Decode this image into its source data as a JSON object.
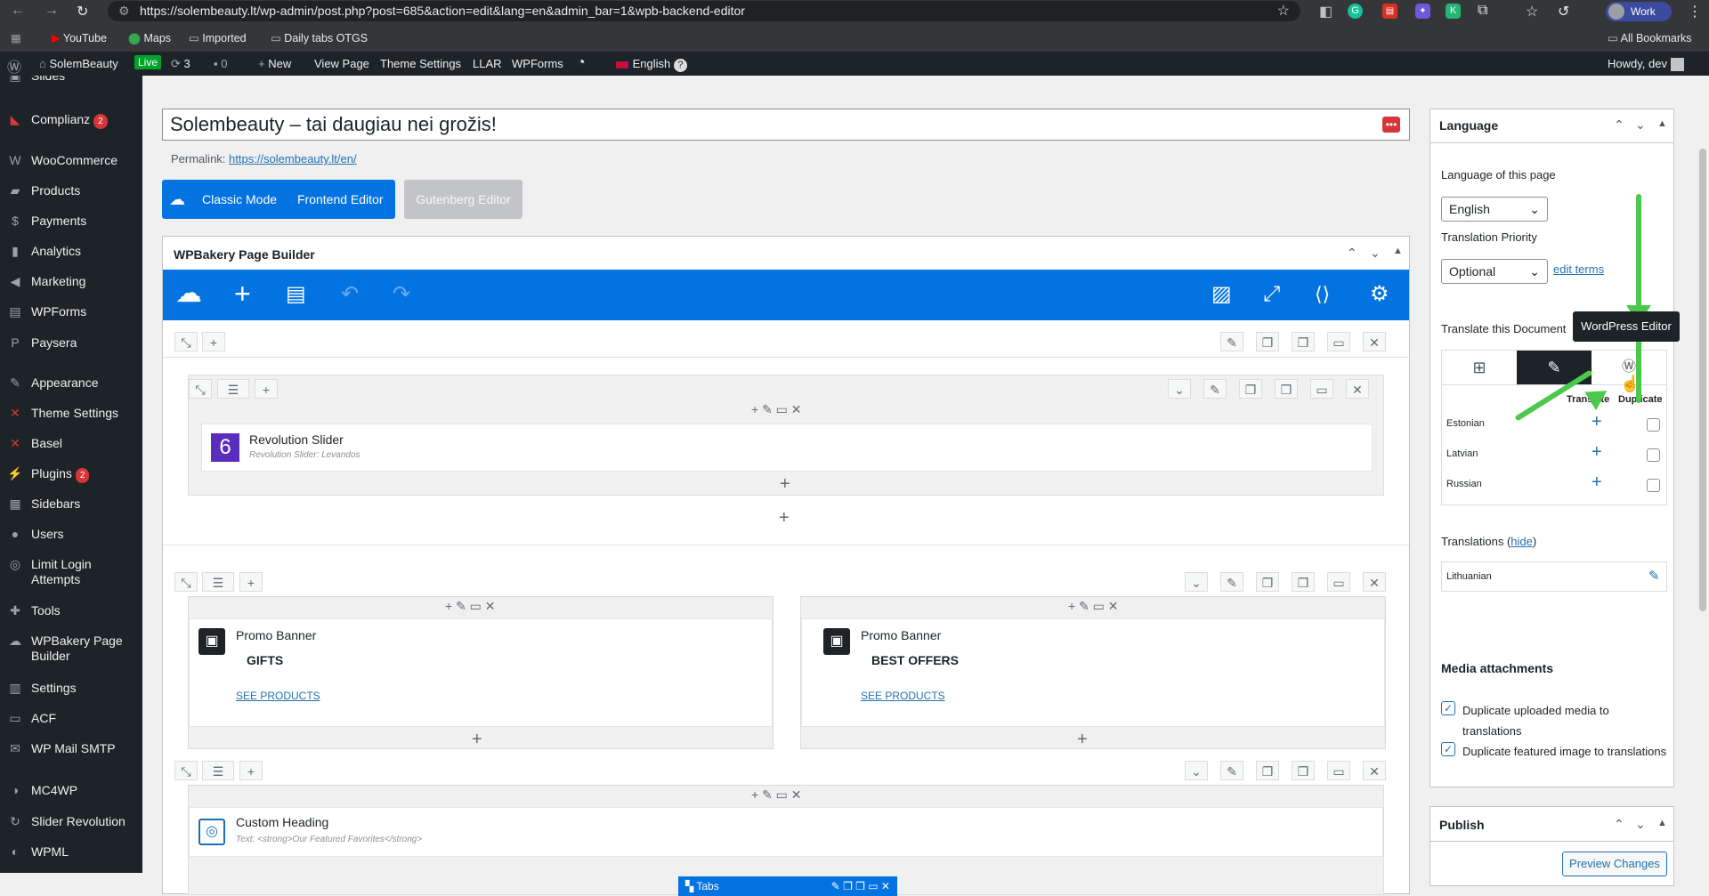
{
  "browser": {
    "url": "https://solembeauty.lt/wp-admin/post.php?post=685&action=edit&lang=en&admin_bar=1&wpb-backend-editor",
    "profile": "Work",
    "bookmarks": [
      "YouTube",
      "Maps",
      "Imported",
      "Daily tabs OTGS"
    ],
    "all_bookmarks": "All Bookmarks"
  },
  "adminbar": {
    "site": "SolemBeauty",
    "live": "Live",
    "updates": "3",
    "comments": "0",
    "new": "New",
    "view_page": "View Page",
    "theme_settings": "Theme Settings",
    "llar": "LLAR",
    "wpforms": "WPForms",
    "language": "English",
    "howdy": "Howdy, dev"
  },
  "sidebar": {
    "items": [
      {
        "label": "Slides",
        "icon": "slides-icon"
      },
      {
        "label": "Complianz",
        "badge": "2",
        "icon": "complianz-icon"
      },
      {
        "label": "WooCommerce",
        "icon": "woo-icon"
      },
      {
        "label": "Products",
        "icon": "products-icon"
      },
      {
        "label": "Payments",
        "icon": "payments-icon"
      },
      {
        "label": "Analytics",
        "icon": "analytics-icon"
      },
      {
        "label": "Marketing",
        "icon": "marketing-icon"
      },
      {
        "label": "WPForms",
        "icon": "wpforms-icon"
      },
      {
        "label": "Paysera",
        "icon": "paysera-icon"
      },
      {
        "label": "Appearance",
        "icon": "appearance-icon"
      },
      {
        "label": "Theme Settings",
        "icon": "theme-icon"
      },
      {
        "label": "Basel",
        "icon": "basel-icon"
      },
      {
        "label": "Plugins",
        "badge": "2",
        "icon": "plugins-icon"
      },
      {
        "label": "Sidebars",
        "icon": "sidebars-icon"
      },
      {
        "label": "Users",
        "icon": "users-icon"
      },
      {
        "label": "Limit Login Attempts",
        "icon": "lock-icon"
      },
      {
        "label": "Tools",
        "icon": "tools-icon"
      },
      {
        "label": "WPBakery Page Builder",
        "icon": "wpbakery-icon"
      },
      {
        "label": "Settings",
        "icon": "settings-icon"
      },
      {
        "label": "ACF",
        "icon": "acf-icon"
      },
      {
        "label": "WP Mail SMTP",
        "icon": "mail-icon"
      },
      {
        "label": "MC4WP",
        "icon": "mc4wp-icon"
      },
      {
        "label": "Slider Revolution",
        "icon": "slider-icon"
      },
      {
        "label": "WPML",
        "icon": "wpml-icon"
      }
    ]
  },
  "editor": {
    "title": "Solembeauty – tai daugiau nei grožis!",
    "permalink_label": "Permalink:",
    "permalink": "https://solembeauty.lt/en/",
    "classic_mode": "Classic Mode",
    "frontend_editor": "Frontend Editor",
    "gutenberg_editor": "Gutenberg Editor",
    "builder_title": "WPBakery Page Builder",
    "revolution_slider": "Revolution Slider",
    "revolution_slider_sub": "Revolution Slider: Levandos",
    "promo1_title": "Promo Banner",
    "promo1_text": "GIFTS",
    "promo1_link": "SEE PRODUCTS",
    "promo2_title": "Promo Banner",
    "promo2_text": "BEST OFFERS",
    "promo2_link": "SEE PRODUCTS",
    "custom_heading": "Custom Heading",
    "custom_heading_sub": "Text: <strong>Our Featured Favorites</strong>",
    "tabs_label": "Tabs"
  },
  "language_box": {
    "title": "Language",
    "lang_of_page_label": "Language of this page",
    "lang_value": "English",
    "priority_label": "Translation Priority",
    "priority_value": "Optional",
    "edit_terms": "edit terms",
    "translate_doc_label": "Translate this Document",
    "tooltip": "WordPress Editor",
    "col_translate": "Translate",
    "col_duplicate": "Duplicate",
    "languages": [
      "Estonian",
      "Latvian",
      "Russian"
    ],
    "translations_label": "Translations",
    "hide": "hide",
    "translation_lang": "Lithuanian",
    "media_title": "Media attachments",
    "media_opt1": "Duplicate uploaded media to translations",
    "media_opt2": "Duplicate featured image to translations"
  },
  "publish_box": {
    "title": "Publish",
    "preview": "Preview Changes"
  },
  "colors": {
    "wpbakery_blue": "#0473e2",
    "admin_dark": "#1d2327",
    "arrow_green": "#4cc84c"
  }
}
